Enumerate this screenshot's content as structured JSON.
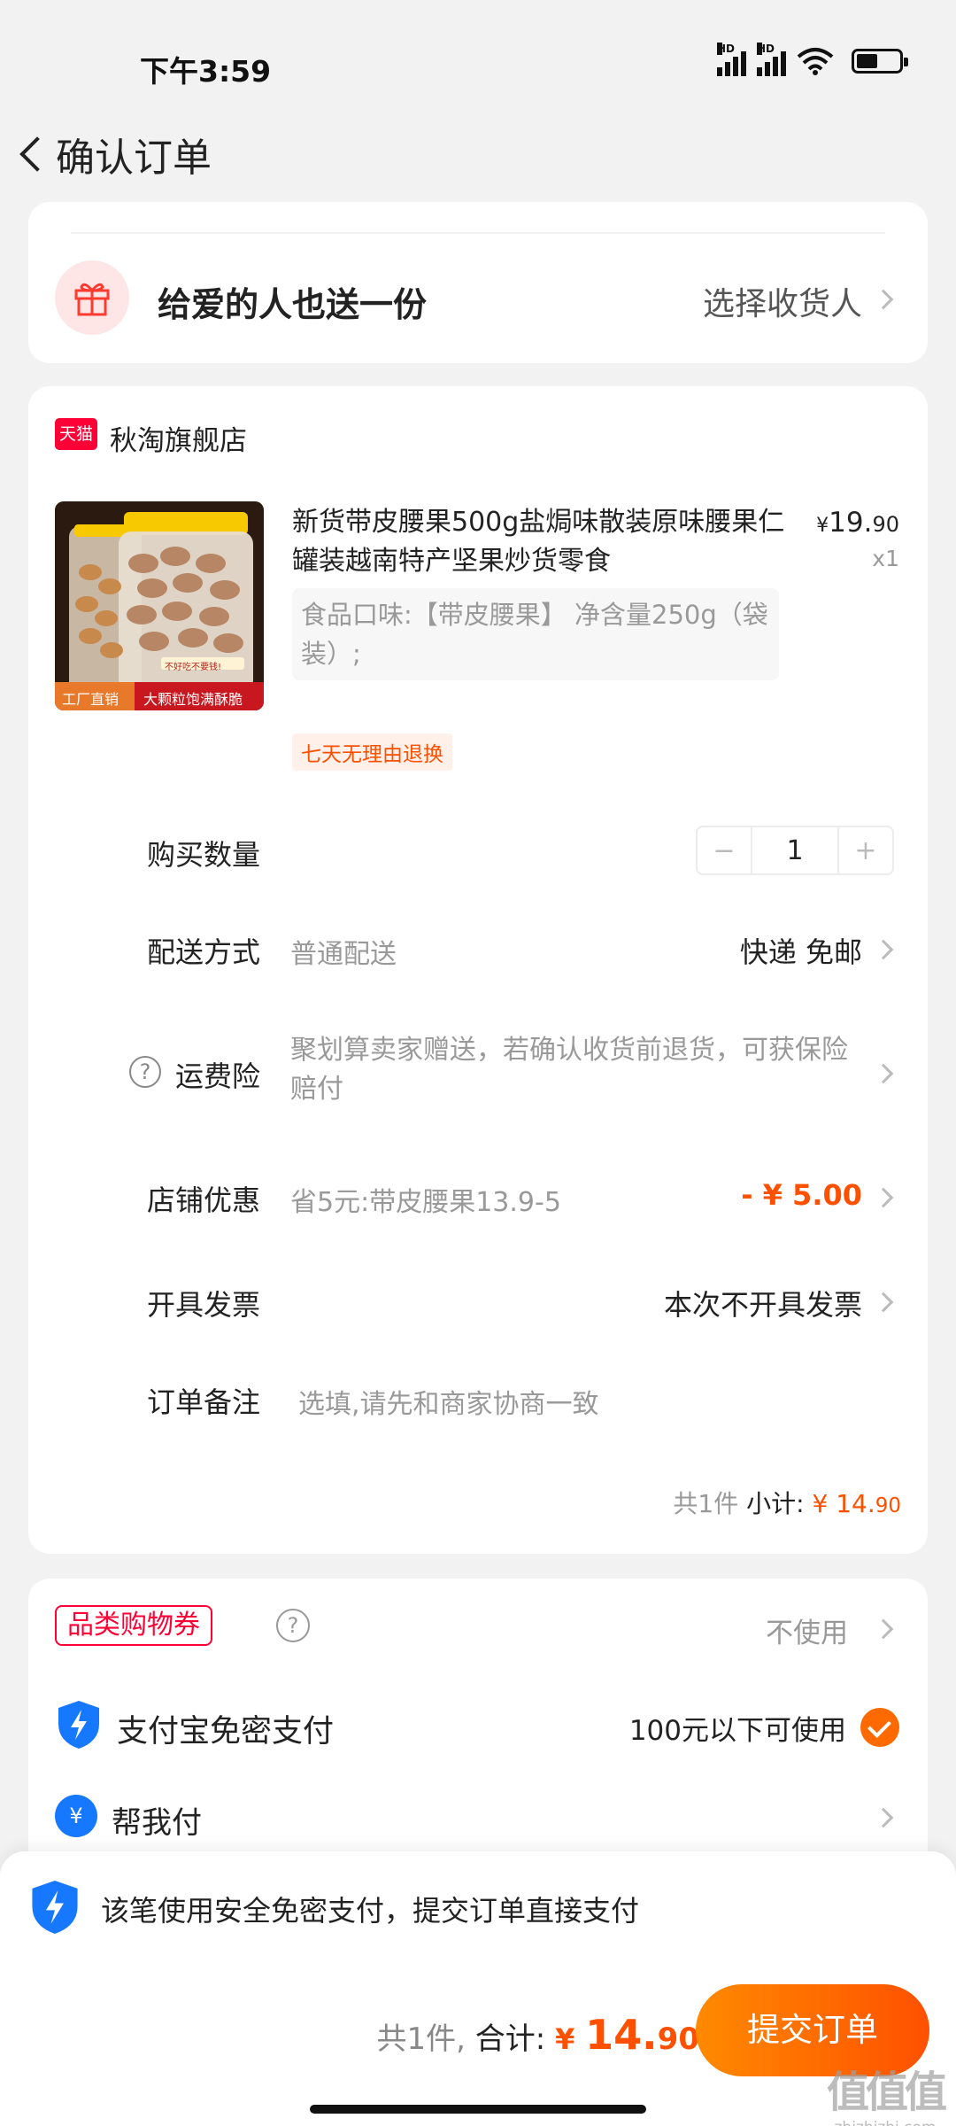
{
  "status_bar": {
    "time": "下午3:59",
    "signal_label": "HD",
    "battery_level": 0.5
  },
  "nav": {
    "title": "确认订单"
  },
  "gift": {
    "label": "给爱的人也送一份",
    "action": "选择收货人"
  },
  "shop": {
    "badge": "天猫",
    "name": "秋淘旗舰店"
  },
  "product": {
    "title": "新货带皮腰果500g盐焗味散装原味腰果仁罐装越南特产坚果炒货零食",
    "price_symbol": "¥",
    "price_int": "19.",
    "price_dec": "90",
    "qty": "x1",
    "spec": "食品口味:【带皮腰果】 净含量250g（袋装）;",
    "return_tag": "七天无理由退换",
    "image_badges": [
      "工厂直销",
      "大颗粒饱满酥脆",
      "不好吃不要钱!"
    ]
  },
  "rows": {
    "quantity": {
      "label": "购买数量",
      "minus": "−",
      "value": "1",
      "plus": "+"
    },
    "delivery": {
      "label": "配送方式",
      "sub": "普通配送",
      "value": "快递 免邮"
    },
    "insurance": {
      "label": "运费险",
      "help": "?",
      "text": "聚划算卖家赠送，若确认收货前退货，可获保险赔付"
    },
    "discount": {
      "label": "店铺优惠",
      "sub": "省5元:带皮腰果13.9-5",
      "value": "- ¥ 5.00"
    },
    "invoice": {
      "label": "开具发票",
      "value": "本次不开具发票"
    },
    "note": {
      "label": "订单备注",
      "placeholder": "选填,请先和商家协商一致"
    }
  },
  "subtotal": {
    "count": "共1件",
    "label": "小计:",
    "symbol": "¥",
    "int": "14.",
    "dec": "90"
  },
  "payment": {
    "coupon_label": "品类购物券",
    "coupon_help": "?",
    "coupon_value": "不使用",
    "alipay_label": "支付宝免密支付",
    "alipay_note": "100元以下可使用",
    "helppay_icon": "¥",
    "helppay_label": "帮我付"
  },
  "bottom": {
    "safe_text": "该笔使用安全免密支付，提交订单直接支付",
    "count": "共1件,",
    "total_label": "合计:",
    "symbol": "¥",
    "int": "14.",
    "dec": "90",
    "submit": "提交订单"
  },
  "watermark": {
    "logo": "值值值",
    "url": "zhizhizhi.com"
  },
  "colors": {
    "accent": "#ff5000",
    "tmall": "#ff0036",
    "alipay": "#1677ff"
  }
}
